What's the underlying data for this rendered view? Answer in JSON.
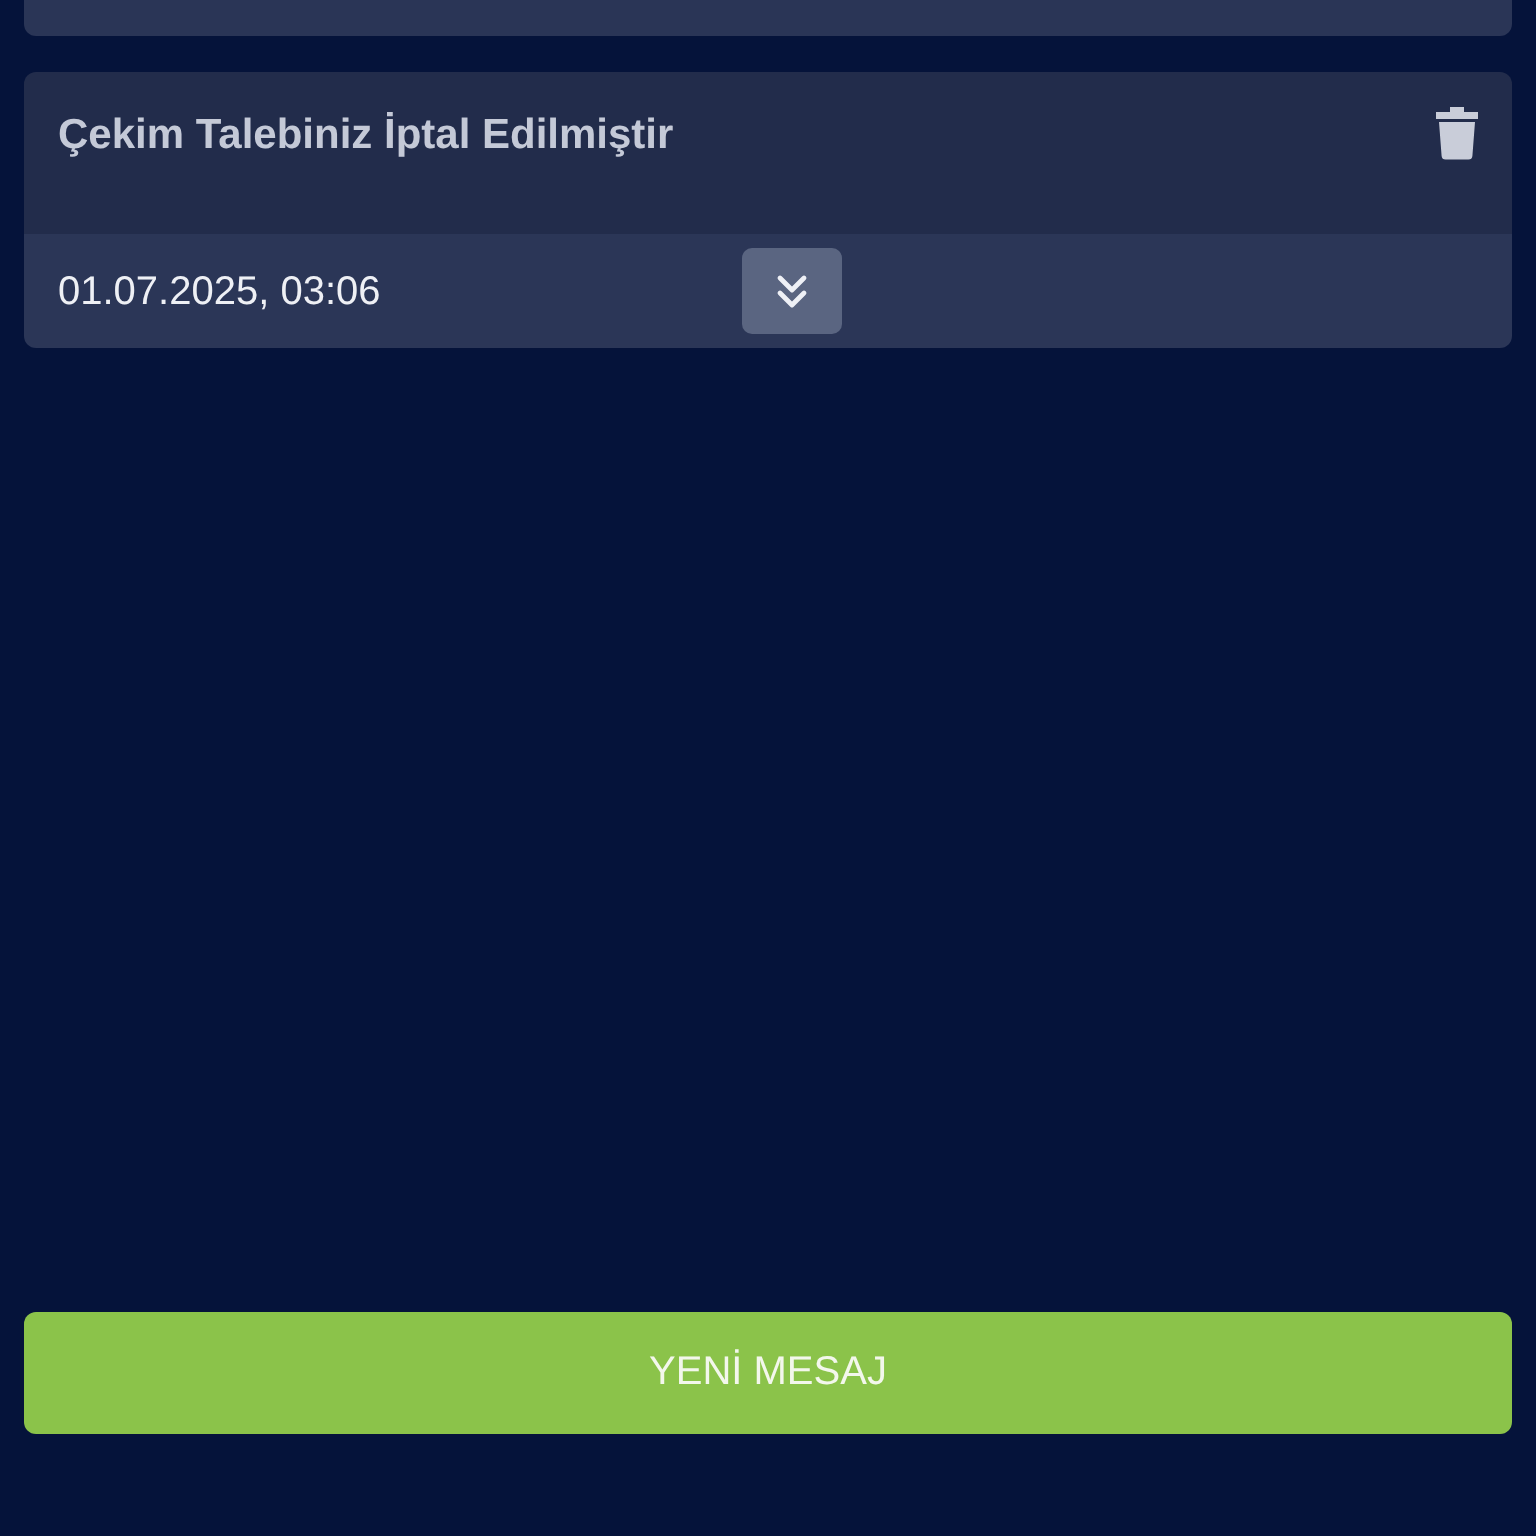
{
  "messages": [
    {
      "title": "Çekim Talebiniz İptal Edilmiştir",
      "date": "01.07.2025, 03:06"
    }
  ],
  "new_message_button": "YENİ MESAJ"
}
